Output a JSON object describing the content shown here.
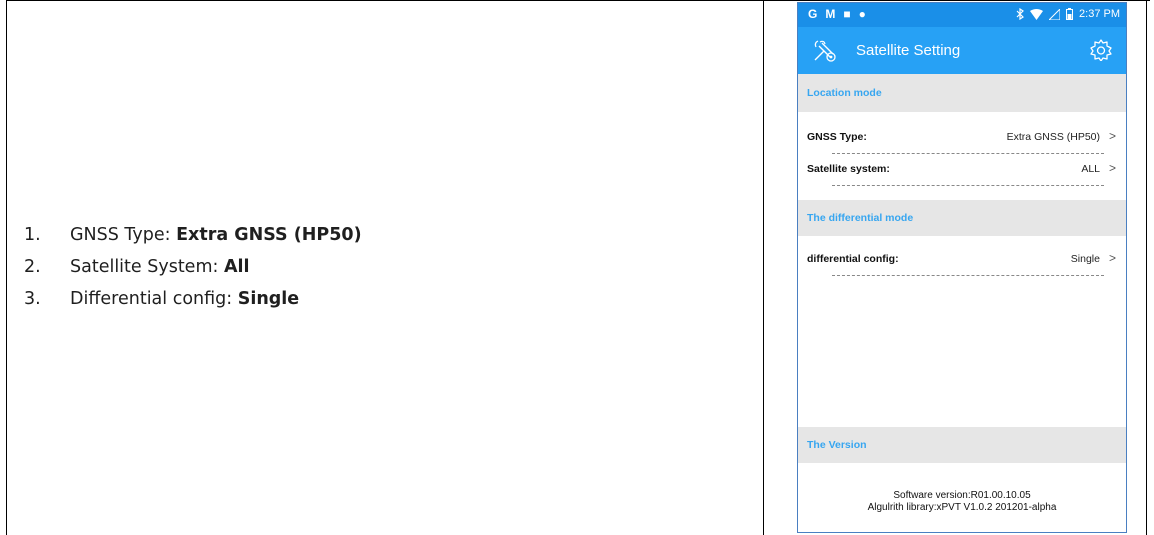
{
  "list": [
    {
      "num": "1.",
      "label": "GNSS Type: ",
      "value": "Extra GNSS (HP50)"
    },
    {
      "num": "2.",
      "label": "Satellite System: ",
      "value": "All"
    },
    {
      "num": "3.",
      "label": "Differential config: ",
      "value": "Single"
    }
  ],
  "phone": {
    "statusbar": {
      "left_icons": [
        "G",
        "M",
        "■",
        "●"
      ],
      "right_icons": [
        "bluetooth-icon",
        "wifi-icon",
        "signal-icon",
        "battery-icon"
      ],
      "time": "2:37 PM"
    },
    "appbar": {
      "title": "Satellite Setting",
      "color": "#27a1f5"
    },
    "sections": {
      "location": "Location mode",
      "differential": "The differential mode",
      "version": "The Version"
    },
    "rows": {
      "gnss_type": {
        "label": "GNSS Type:",
        "value": "Extra GNSS (HP50)"
      },
      "satellite_system": {
        "label": "Satellite system:",
        "value": "ALL"
      },
      "differential_config": {
        "label": "differential config:",
        "value": "Single"
      }
    },
    "chevron": ">",
    "version": {
      "software": "Software version:R01.00.10.05",
      "library": "Algulrith library:xPVT V1.0.2 201201-alpha"
    }
  }
}
